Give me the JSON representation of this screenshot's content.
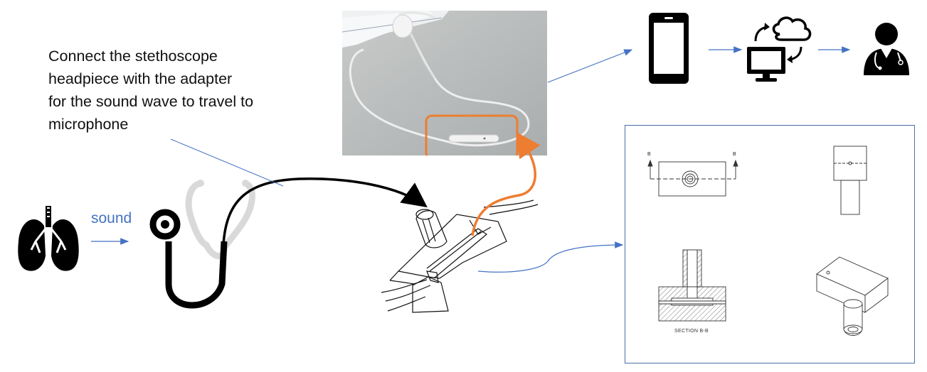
{
  "caption": {
    "lines": [
      "Connect the stethoscope",
      "headpiece with the adapter",
      "for the sound wave to travel to",
      "microphone"
    ]
  },
  "sound_label": "sound",
  "cad": {
    "section_label": "SECTION B-B",
    "section_marker_left": "B",
    "section_marker_right": "B"
  },
  "icons": [
    "lungs-icon",
    "stethoscope-icon",
    "smartphone-icon",
    "computer-cloud-sync-icon",
    "doctor-icon"
  ],
  "colors": {
    "arrow_blue": "#4472c4",
    "sound_text": "#4472c4",
    "highlight_orange": "#ed7d31",
    "frame_blue": "#4a6fa5"
  }
}
